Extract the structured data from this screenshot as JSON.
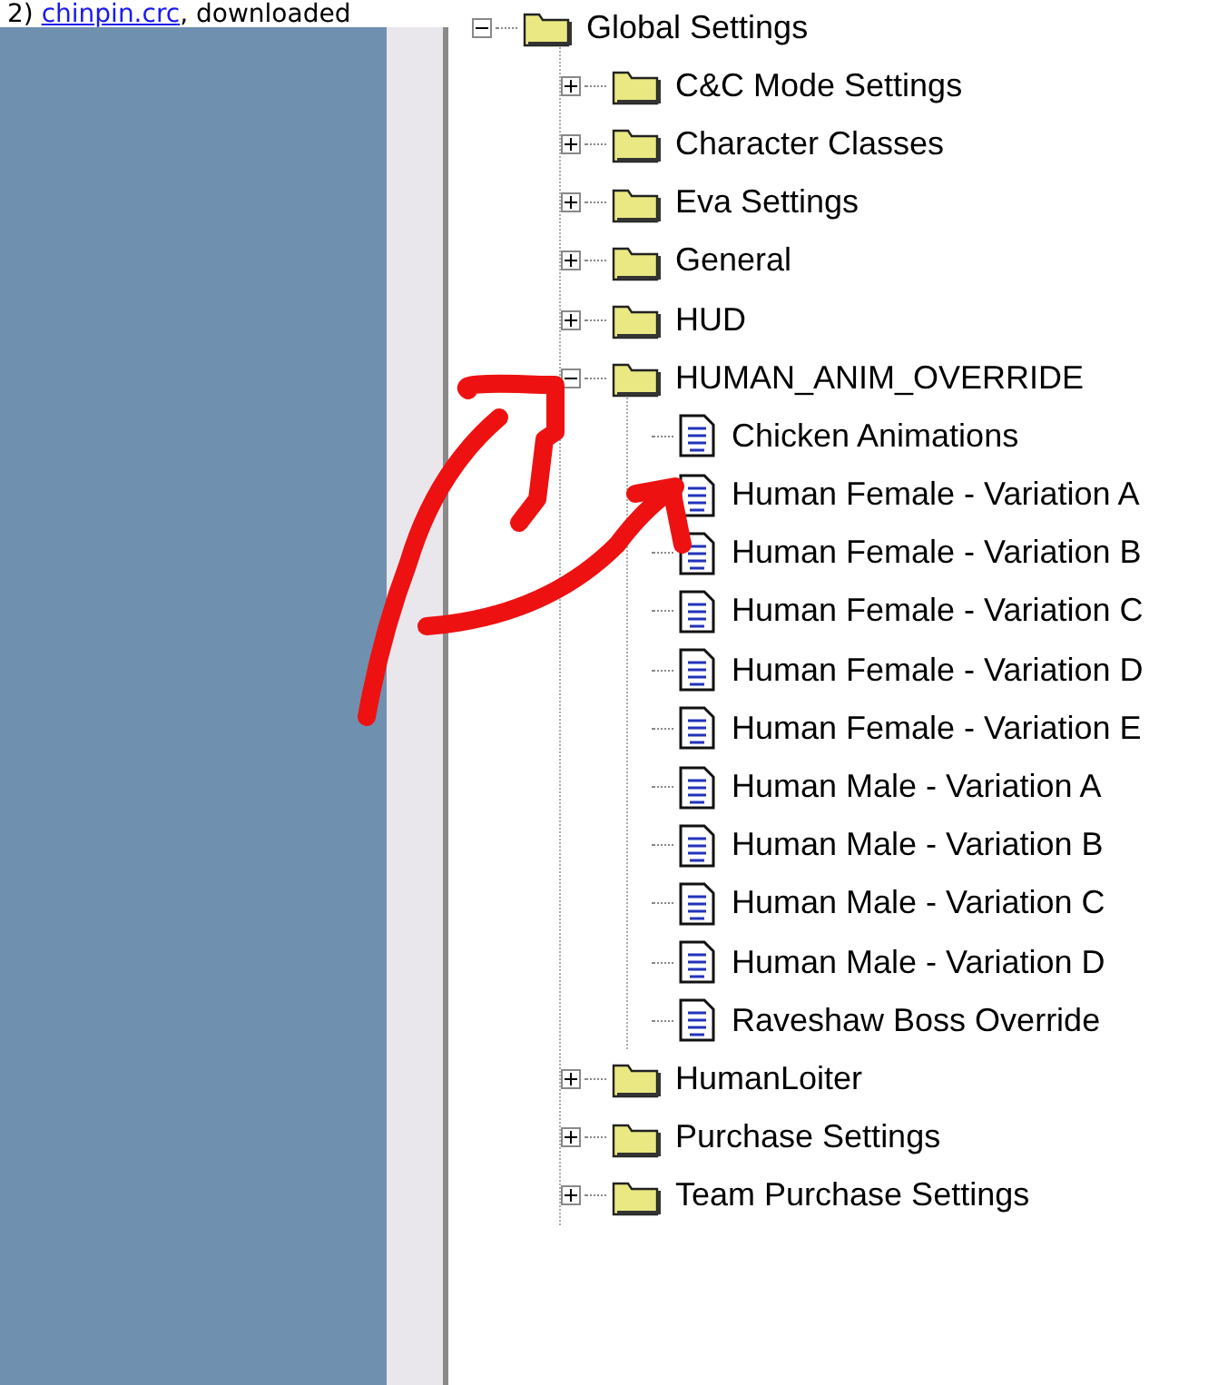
{
  "header": {
    "number": "2)",
    "link": "chinpin.crc",
    "text": ", downloaded"
  },
  "tree": [
    {
      "label": "Global Settings",
      "kind": "folder",
      "expanded": true,
      "children": [
        {
          "label": "C&C Mode Settings",
          "kind": "folder",
          "expanded": false
        },
        {
          "label": "Character Classes",
          "kind": "folder",
          "expanded": false
        },
        {
          "label": "Eva Settings",
          "kind": "folder",
          "expanded": false
        },
        {
          "label": "General",
          "kind": "folder",
          "expanded": false
        },
        {
          "label": "HUD",
          "kind": "folder",
          "expanded": false
        },
        {
          "label": "HUMAN_ANIM_OVERRIDE",
          "kind": "folder",
          "expanded": true,
          "children": [
            {
              "label": "Chicken Animations",
              "kind": "document"
            },
            {
              "label": "Human Female - Variation A",
              "kind": "document"
            },
            {
              "label": "Human Female - Variation B",
              "kind": "document"
            },
            {
              "label": "Human Female - Variation C",
              "kind": "document"
            },
            {
              "label": "Human Female - Variation D",
              "kind": "document"
            },
            {
              "label": "Human Female - Variation E",
              "kind": "document"
            },
            {
              "label": "Human Male - Variation A",
              "kind": "document"
            },
            {
              "label": "Human Male - Variation B",
              "kind": "document"
            },
            {
              "label": "Human Male - Variation C",
              "kind": "document"
            },
            {
              "label": "Human Male - Variation D",
              "kind": "document"
            },
            {
              "label": "Raveshaw Boss Override",
              "kind": "document"
            }
          ]
        },
        {
          "label": "HumanLoiter",
          "kind": "folder",
          "expanded": false
        },
        {
          "label": "Purchase Settings",
          "kind": "folder",
          "expanded": false
        },
        {
          "label": "Team Purchase Settings",
          "kind": "folder",
          "expanded": false
        }
      ]
    }
  ]
}
